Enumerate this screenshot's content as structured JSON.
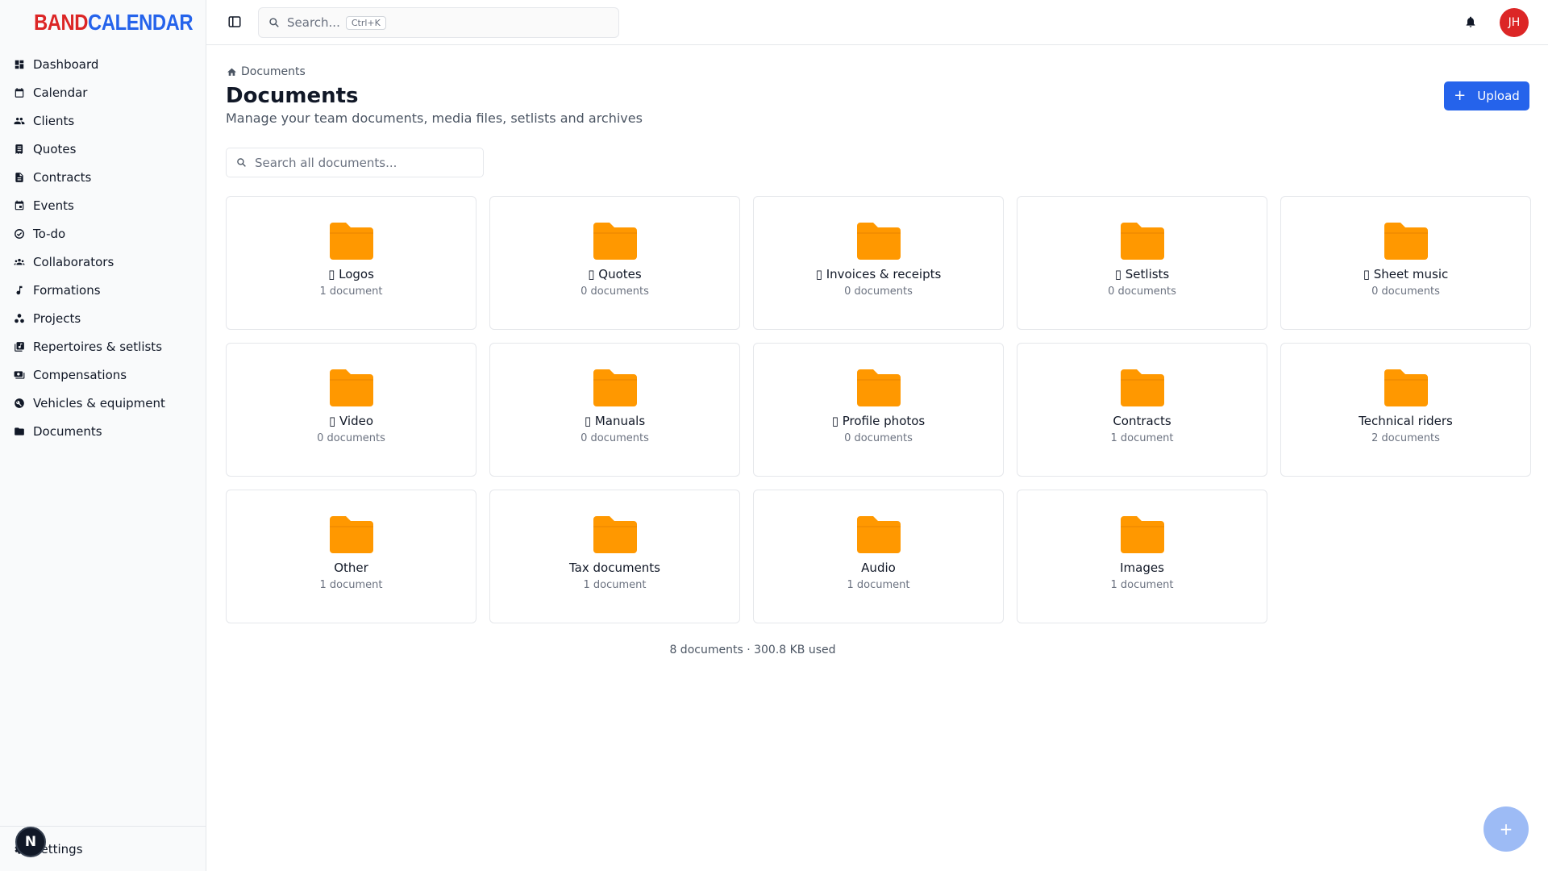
{
  "brand": {
    "part1": "BAND",
    "part2": "CALENDAR"
  },
  "colors": {
    "accent": "#2563eb",
    "brand_red": "#dc2626",
    "folder": "#ff9800"
  },
  "sidebar": {
    "items": [
      {
        "label": "Dashboard",
        "icon": "dashboard-icon"
      },
      {
        "label": "Calendar",
        "icon": "calendar-icon"
      },
      {
        "label": "Clients",
        "icon": "people-icon"
      },
      {
        "label": "Quotes",
        "icon": "receipt-icon"
      },
      {
        "label": "Contracts",
        "icon": "document-icon"
      },
      {
        "label": "Events",
        "icon": "event-icon"
      },
      {
        "label": "To-do",
        "icon": "check-circle-icon"
      },
      {
        "label": "Collaborators",
        "icon": "group-icon"
      },
      {
        "label": "Formations",
        "icon": "music-note-icon"
      },
      {
        "label": "Projects",
        "icon": "hub-icon"
      },
      {
        "label": "Repertoires & setlists",
        "icon": "library-music-icon"
      },
      {
        "label": "Compensations",
        "icon": "payments-icon"
      },
      {
        "label": "Vehicles & equipment",
        "icon": "build-circle-icon"
      },
      {
        "label": "Documents",
        "icon": "folder-icon"
      }
    ],
    "footer": {
      "label": "Settings",
      "icon": "gear-icon"
    },
    "badge": "N"
  },
  "topbar": {
    "search_placeholder": "Search...",
    "shortcut": "Ctrl+K",
    "avatar": "JH"
  },
  "page": {
    "breadcrumb": "Documents",
    "title": "Documents",
    "subtitle": "Manage your team documents, media files, setlists and archives",
    "upload_label": "Upload",
    "search_placeholder": "Search all documents..."
  },
  "folders": [
    {
      "name": "▯ Logos",
      "count": "1 document"
    },
    {
      "name": "▯ Quotes",
      "count": "0 documents"
    },
    {
      "name": "▯ Invoices & receipts",
      "count": "0 documents"
    },
    {
      "name": "▯ Setlists",
      "count": "0 documents"
    },
    {
      "name": "▯ Sheet music",
      "count": "0 documents"
    },
    {
      "name": "▯ Video",
      "count": "0 documents"
    },
    {
      "name": "▯ Manuals",
      "count": "0 documents"
    },
    {
      "name": "▯ Profile photos",
      "count": "0 documents"
    },
    {
      "name": "Contracts",
      "count": "1 document"
    },
    {
      "name": "Technical riders",
      "count": "2 documents"
    },
    {
      "name": "Other",
      "count": "1 document"
    },
    {
      "name": "Tax documents",
      "count": "1 document"
    },
    {
      "name": "Audio",
      "count": "1 document"
    },
    {
      "name": "Images",
      "count": "1 document"
    }
  ],
  "storage_summary": "8 documents · 300.8 KB used",
  "fab_label": "+"
}
